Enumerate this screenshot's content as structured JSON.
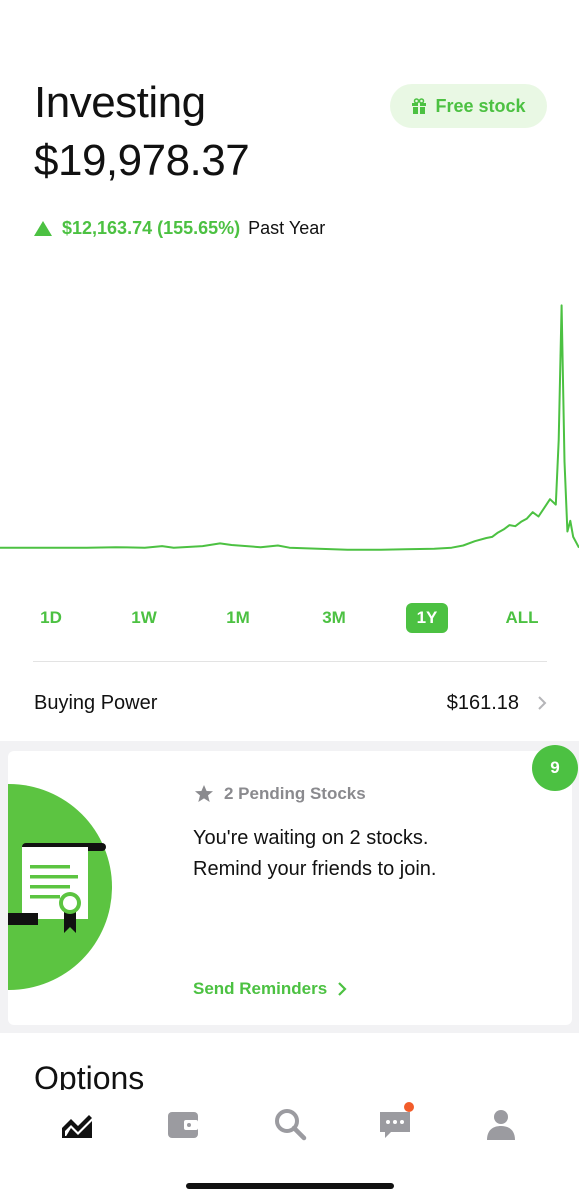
{
  "header": {
    "title": "Investing",
    "portfolio_value": "$19,978.37",
    "free_stock_label": "Free stock"
  },
  "change": {
    "direction": "up",
    "amount": "$12,163.74 (155.65%)",
    "period": "Past Year"
  },
  "chart_data": {
    "type": "line",
    "x": [
      0,
      5,
      10,
      15,
      20,
      25,
      28,
      30,
      35,
      38,
      40,
      45,
      48,
      50,
      55,
      60,
      65,
      70,
      75,
      78,
      80,
      82,
      84,
      85,
      86,
      87,
      88,
      89,
      90,
      91,
      92,
      93,
      94,
      95,
      96,
      96.5,
      97,
      97.5,
      98,
      98.5,
      99,
      100
    ],
    "values": [
      0,
      0,
      0,
      0,
      0.5,
      0,
      1.5,
      0,
      1.5,
      4,
      2.5,
      0.5,
      2,
      0,
      -1,
      -2,
      -2,
      -1.5,
      -1,
      0,
      2,
      6,
      9,
      10,
      14,
      17,
      21,
      20,
      24,
      27,
      33,
      29,
      37,
      45,
      40,
      100,
      225,
      80,
      15,
      25,
      10,
      0
    ],
    "title": "",
    "xlabel": "",
    "ylabel": "",
    "grid": false,
    "color": "#4cc142"
  },
  "ranges": {
    "items": [
      {
        "label": "1D"
      },
      {
        "label": "1W"
      },
      {
        "label": "1M"
      },
      {
        "label": "3M"
      },
      {
        "label": "1Y",
        "active": true
      },
      {
        "label": "ALL"
      }
    ]
  },
  "buying_power": {
    "label": "Buying Power",
    "value": "$161.18"
  },
  "card": {
    "badge_count": "9",
    "pending_label": "2 Pending Stocks",
    "body_line1": "You're waiting on 2 stocks.",
    "body_line2": "Remind your friends to join.",
    "link_label": "Send Reminders"
  },
  "options": {
    "title": "Options"
  },
  "tabbar": {
    "items": [
      {
        "icon": "chart-icon",
        "active": true
      },
      {
        "icon": "wallet-icon"
      },
      {
        "icon": "search-icon"
      },
      {
        "icon": "messages-icon",
        "notification": true
      },
      {
        "icon": "account-icon"
      }
    ]
  },
  "colors": {
    "accent": "#4cc142",
    "accent_light": "#e9f8e4",
    "notification": "#f25c2a"
  }
}
